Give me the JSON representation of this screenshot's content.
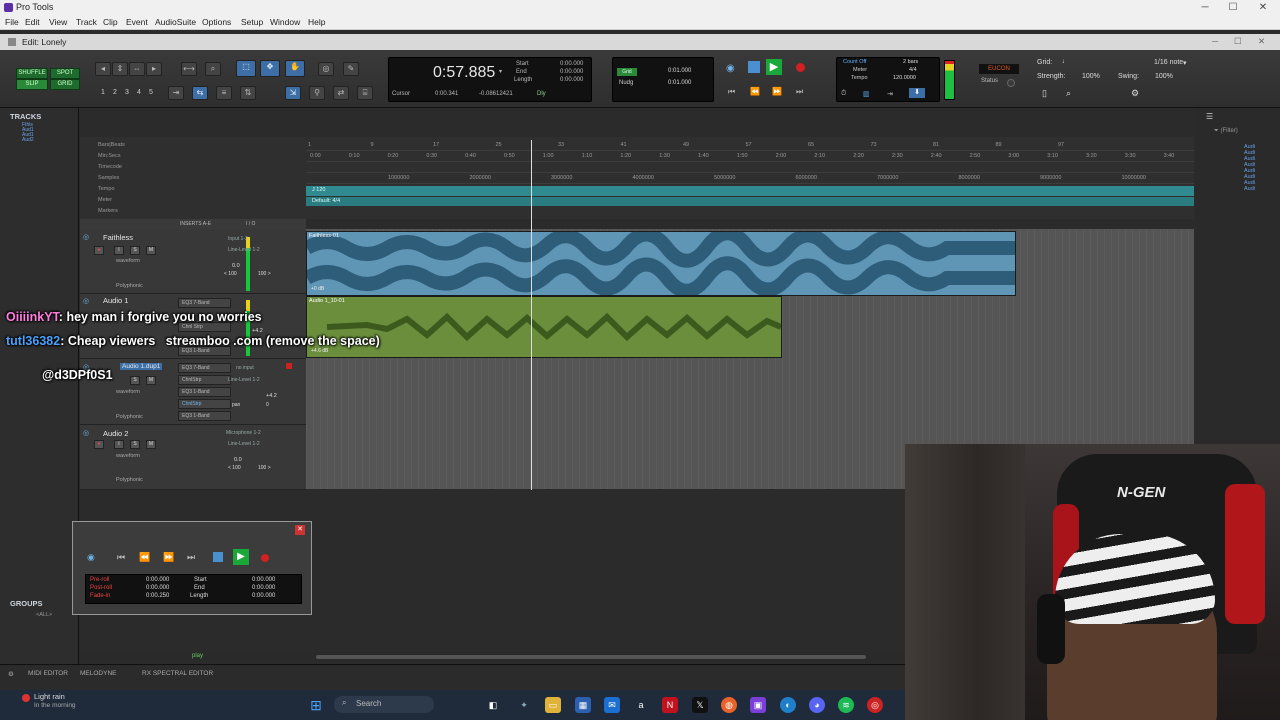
{
  "window": {
    "app_title": "Pro Tools",
    "edit_window_title": "Edit: Lonely"
  },
  "menu": [
    "File",
    "Edit",
    "View",
    "Track",
    "Clip",
    "Event",
    "AudioSuite",
    "Options",
    "Setup",
    "Window",
    "Help"
  ],
  "toolbar": {
    "mode_shuffle": "SHUFFLE",
    "mode_spot": "SPOT",
    "mode_slip": "SLIP",
    "mode_grid": "GRID",
    "zoom_presets": [
      "1",
      "2",
      "3",
      "4",
      "5"
    ],
    "counter_main": "0:57.885",
    "start_label": "Start",
    "end_label": "End",
    "length_label": "Length",
    "start_value": "0:00.000",
    "end_value": "0:00.000",
    "length_value": "0:00.000",
    "cursor_label": "Cursor",
    "cursor_value": "0:00.341",
    "cursor_db": "-0.08612421",
    "dly_label": "Dly",
    "grid_label": "Grid",
    "nudge_label": "Nudg",
    "grid_value": "0:01.000",
    "nudge_value": "0:01.000",
    "count_off": "Count Off",
    "meter_label": "Meter",
    "tempo_label": "Tempo",
    "bars": "2 bars",
    "meter_value": "4/4",
    "tempo_value": "120.0000",
    "status_name": "EUCON",
    "status_label": "Status",
    "grid_note_label": "Grid:",
    "grid_note": "1/16 note",
    "strength_label": "Strength:",
    "strength_value": "100%",
    "swing_label": "Swing:",
    "swing_value": "100%"
  },
  "tracks_panel": {
    "title": "TRACKS",
    "items": [
      "Fthls",
      "Aud1",
      "Aud1",
      "Aud2"
    ],
    "groups_title": "GROUPS",
    "groups_all": "<ALL>"
  },
  "rulers": {
    "labels": [
      "Bars|Beats",
      "Min:Secs",
      "Timecode",
      "Samples",
      "Tempo",
      "Meter",
      "Markers"
    ],
    "min_secs": [
      "0:00",
      "0:10",
      "0:20",
      "0:30",
      "0:40",
      "0:50",
      "1:00",
      "1:10",
      "1:20",
      "1:30",
      "1:40",
      "1:50",
      "2:00",
      "2:10",
      "2:20",
      "2:30",
      "2:40",
      "2:50",
      "3:00",
      "3:10",
      "3:20",
      "3:30",
      "3:40"
    ],
    "bars": [
      "1",
      "9",
      "17",
      "25",
      "33",
      "41",
      "49",
      "57",
      "65",
      "73",
      "81",
      "89",
      "97"
    ],
    "samples": [
      "1000000",
      "2000000",
      "3000000",
      "4000000",
      "5000000",
      "6000000",
      "7000000",
      "8000000",
      "9000000",
      "10000000"
    ],
    "tempo_marker": "J 120",
    "meter_marker": "Default: 4/4"
  },
  "column_heads": {
    "inserts": "INSERTS A-E",
    "io": "I / O"
  },
  "tracks": [
    {
      "name": "Faithless",
      "view": "waveform",
      "vol": "0.0",
      "pan_l": "< 100",
      "pan_r": "100 >",
      "input": "Input 1-2",
      "output": "Line-Level 1-2",
      "clip": "Faithless-01",
      "auto": "Polyphonic",
      "clipdb": "+0 dB"
    },
    {
      "name": "Audio 1",
      "view": "waveform",
      "vol": "+4.2",
      "pan_l": "",
      "pan_r": "",
      "input": "Input 1-2",
      "output": "Line-Level 1-2",
      "clip": "Audio 1_10-01",
      "auto": "Polyphonic",
      "inserts": [
        "EQ3 7-Band",
        "Chnl Strp",
        "EQ3 1-Band"
      ],
      "clipdb": "+4.6 dB"
    },
    {
      "name": "Audio 1.dup1",
      "view": "waveform",
      "vol": "+4.2",
      "pan_l": "pan",
      "pan_r": "0",
      "input": "no input",
      "output": "Line-Level 1-2",
      "auto": "Polyphonic",
      "inserts": [
        "EQ3 7-Band",
        "ChnlStrp",
        "EQ3 1-Band",
        "ChnlStrp",
        "EQ3 1-Band"
      ]
    },
    {
      "name": "Audio 2",
      "view": "waveform",
      "vol": "0.0",
      "pan_l": "< 100",
      "pan_r": "100 >",
      "input": "Microphone 1-2",
      "output": "Line-Level 1-2",
      "auto": "Polyphonic"
    }
  ],
  "mini_transport": {
    "preroll_label": "Pre-roll",
    "postroll_label": "Post-roll",
    "fadein_label": "Fade-in",
    "preroll": "0:00.000",
    "postroll": "0:00.000",
    "fadein": "0:00.250",
    "start_label": "Start",
    "end_label": "End",
    "length_label": "Length",
    "start": "0:00.000",
    "end": "0:00.000",
    "length": "0:00.000"
  },
  "bottom_bar": {
    "midi_editor": "MIDI EDITOR",
    "melodyne": "MELODYNE",
    "rx": "RX SPECTRAL EDITOR",
    "play": "play"
  },
  "chat": [
    {
      "user": "OiiiinkYT",
      "message": "hey man i forgive you no worries",
      "color": "#ff7de0"
    },
    {
      "user": "tutl36382",
      "message": "Cheap viewers   streamboo .com (remove the space)",
      "color": "#4aa3ff"
    },
    {
      "user": "",
      "message": "@d3DPf0S1",
      "color": "#ffffff"
    }
  ],
  "taskbar": {
    "weather_title": "Light rain",
    "weather_sub": "In the morning",
    "search_placeholder": "Search"
  },
  "webcam": {
    "chair_logo": "N-GEN"
  },
  "colors": {
    "accent_blue": "#3d6fa6",
    "clip_blue": "#5f95b5",
    "clip_green": "#6a8e3c",
    "tempo_teal": "#2f8b8f",
    "record_red": "#d32020",
    "play_green": "#2ec840"
  }
}
